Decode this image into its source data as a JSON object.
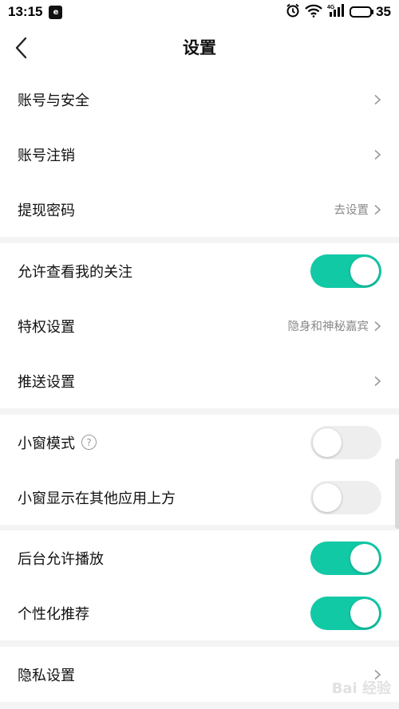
{
  "status_bar": {
    "time": "13:15",
    "app_icon": "app-notification-icon",
    "icons": [
      "alarm-icon",
      "wifi-icon",
      "signal-4g-icon"
    ],
    "battery_level": "35"
  },
  "header": {
    "title": "设置",
    "back_icon": "chevron-left-icon"
  },
  "groups": {
    "account": {
      "account_security": "账号与安全",
      "account_cancel": "账号注销",
      "withdraw_password": "提现密码",
      "withdraw_password_hint": "去设置"
    },
    "privacy": {
      "allow_view_follow": "允许查看我的关注",
      "allow_view_follow_on": true,
      "privilege": "特权设置",
      "privilege_hint": "隐身和神秘嘉宾",
      "push": "推送设置"
    },
    "window": {
      "mini_window": "小窗模式",
      "mini_window_on": false,
      "mini_window_overlay": "小窗显示在其他应用上方",
      "mini_window_overlay_on": false
    },
    "playback": {
      "background_play": "后台允许播放",
      "background_play_on": true,
      "personalized": "个性化推荐",
      "personalized_on": true
    },
    "privacy_settings": {
      "privacy": "隐私设置"
    }
  },
  "colors": {
    "accent": "#12c9a6",
    "toggle_off": "#eeeeee",
    "divider": "#f4f4f4"
  },
  "watermark": "Bai 经验"
}
